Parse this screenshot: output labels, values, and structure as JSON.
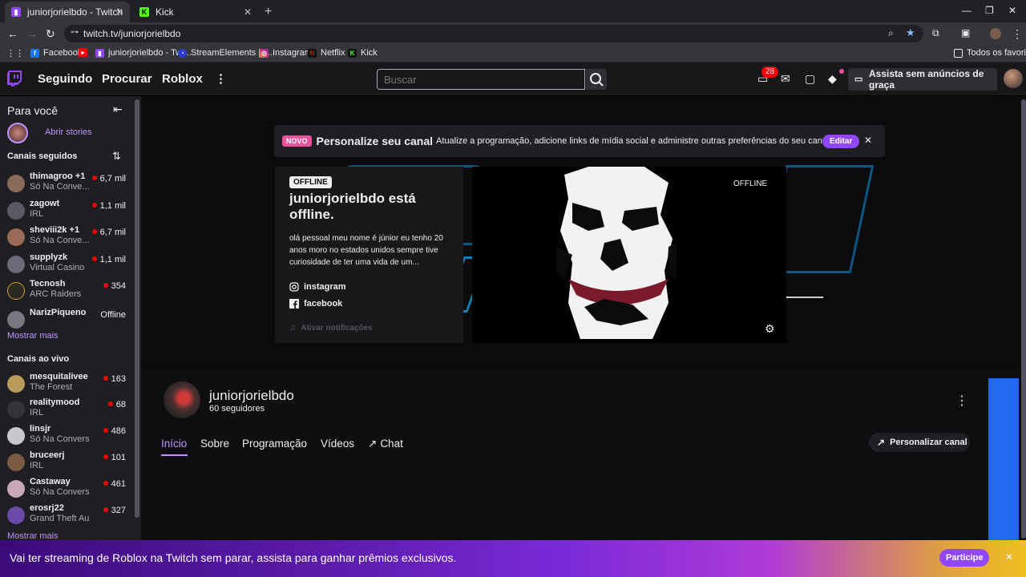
{
  "browser": {
    "tabs": [
      {
        "title": "juniorjorielbdo - Twitch",
        "active": true
      },
      {
        "title": "Kick",
        "active": false
      }
    ],
    "url": "twitch.tv/juniorjorielbdo",
    "bookmarks": [
      "Facebook",
      "juniorjorielbdo - Twi...",
      "StreamElements | T...",
      "Instagram",
      "Netflix",
      "Kick"
    ],
    "all_bookmarks": "Todos os favoritos"
  },
  "nav": {
    "links": [
      "Seguindo",
      "Procurar",
      "Roblox"
    ],
    "search_placeholder": "Buscar",
    "notif_count": "28",
    "promo_button": "Assista sem anúncios de graça"
  },
  "sidebar": {
    "title": "Para você",
    "stories": "Abrir stories",
    "followed_title": "Canais seguidos",
    "followed": [
      {
        "name": "thimagroo +1",
        "game": "Só Na Conve...",
        "viewers": "6,7 mil",
        "live": true
      },
      {
        "name": "zagowt",
        "game": "IRL",
        "viewers": "1,1 mil",
        "live": true
      },
      {
        "name": "sheviii2k +1",
        "game": "Só Na Conve...",
        "viewers": "6,7 mil",
        "live": true
      },
      {
        "name": "supplyzk",
        "game": "Virtual Casino",
        "viewers": "1,1 mil",
        "live": true
      },
      {
        "name": "Tecnosh",
        "game": "ARC Raiders",
        "viewers": "354",
        "live": true
      },
      {
        "name": "NarizPiqueno",
        "game": "",
        "viewers": "Offline",
        "live": false
      }
    ],
    "show_more": "Mostrar mais",
    "live_title": "Canais ao vivo",
    "live": [
      {
        "name": "mesquitalivee",
        "game": "The Forest",
        "viewers": "163"
      },
      {
        "name": "realitymood",
        "game": "IRL",
        "viewers": "68"
      },
      {
        "name": "linsjr",
        "game": "Só Na Conversa",
        "viewers": "486"
      },
      {
        "name": "bruceerj",
        "game": "IRL",
        "viewers": "101"
      },
      {
        "name": "Castaway",
        "game": "Só Na Conversa",
        "viewers": "461"
      },
      {
        "name": "erosrj22",
        "game": "Grand Theft Au...",
        "viewers": "327"
      }
    ],
    "show_more_live": "Mostrar mais"
  },
  "notice": {
    "badge": "NOVO",
    "title": "Personalize seu canal",
    "text": "Atualize a programação, adicione links de mídia social e administre outras preferências do seu canal",
    "edit": "Editar"
  },
  "offline_card": {
    "badge": "OFFLINE",
    "title": "juniorjorielbdo está offline.",
    "description": "olá pessoal meu nome é júnior eu tenho 20 anos moro no estados unidos sempre tive curiosidade de ter uma vida de um...",
    "instagram": "instagram",
    "facebook": "facebook",
    "notifications": "Ativar notificações"
  },
  "player": {
    "status": "OFFLINE"
  },
  "channel": {
    "name": "juniorjorielbdo",
    "followers": "60 seguidores",
    "tabs": [
      "Início",
      "Sobre",
      "Programação",
      "Vídeos",
      "Chat"
    ],
    "customize": "Personalizar canal"
  },
  "promo": {
    "text": "Vai ter streaming de Roblox na Twitch sem parar, assista para ganhar prêmios exclusivos.",
    "button": "Participe"
  },
  "colors": {
    "accent": "#9147ff",
    "link": "#bf94ff",
    "live": "#eb0400",
    "novo": "#e9539b"
  }
}
